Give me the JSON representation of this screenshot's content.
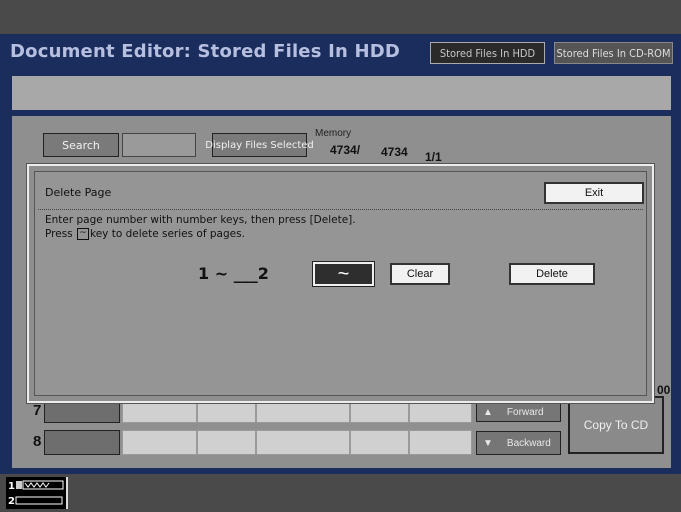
{
  "header": {
    "title": "Document Editor: Stored Files In HDD",
    "tab_hdd": "Stored Files In HDD",
    "tab_cdrom": "Stored Files In CD-ROM"
  },
  "toolbar": {
    "search_label": "Search",
    "display_files_label": "Display Files Selected",
    "memory_label": "Memory",
    "memory_used": "4734/",
    "memory_total": "4734",
    "page_indicator": "1/1"
  },
  "rows": [
    {
      "number": "7"
    },
    {
      "number": "8"
    }
  ],
  "nav": {
    "forward_label": "Forward",
    "backward_label": "Backward",
    "copy_to_cd_label": "Copy To CD",
    "partial_page_number": "00"
  },
  "dialog": {
    "title": "Delete Page",
    "exit_label": "Exit",
    "instruction_line1": "Enter page number with number keys, then press [Delete].",
    "instruction_line2_pre": "Press",
    "instruction_line2_post": "key to delete series of pages.",
    "range_start": "1",
    "range_separator": "~",
    "range_end": "___2",
    "tilde_button_label": "~",
    "clear_label": "Clear",
    "delete_label": "Delete"
  },
  "status": {
    "line1": "1",
    "line2": "2"
  },
  "colors": {
    "panel_bg": "#1b2d5c",
    "title_text": "#b7bfe0",
    "area_bg": "#8f8f8f",
    "msg_bar": "#a8a8a8"
  }
}
